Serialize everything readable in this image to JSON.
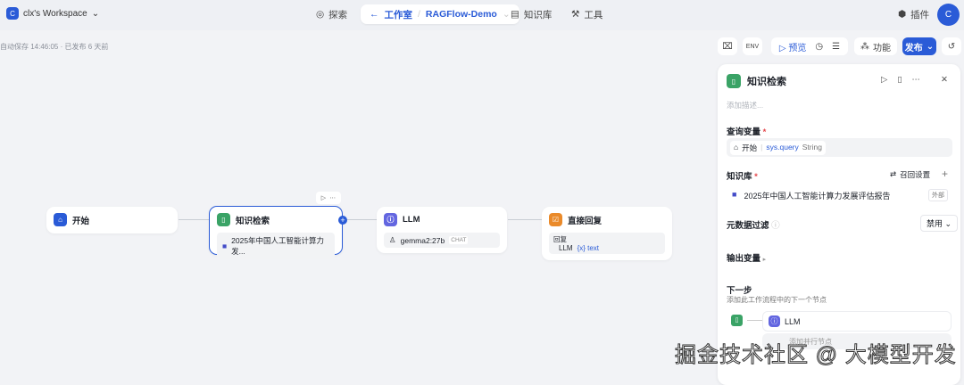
{
  "header": {
    "workspace_initial": "C",
    "workspace": "clx's Workspace",
    "explore": "探索",
    "studio": "工作室",
    "app": "RAGFlow-Demo",
    "knowledge": "知识库",
    "tools": "工具",
    "plugins": "插件",
    "user_initial": "C"
  },
  "status": "自动保存 14:46:05 · 已发布 6 天前",
  "toolbar": {
    "preview": "预览",
    "features": "功能",
    "publish": "发布"
  },
  "nodes": {
    "start": {
      "title": "开始"
    },
    "kr": {
      "title": "知识检索",
      "dataset": "2025年中国人工智能计算力发..."
    },
    "llm": {
      "title": "LLM",
      "model": "gemma2:27b",
      "badge": "CHAT"
    },
    "answer": {
      "title": "直接回复",
      "label": "回复",
      "src": "LLM",
      "var": "{x} text"
    }
  },
  "panel": {
    "title": "知识检索",
    "desc_placeholder": "添加描述...",
    "query_label": "查询变量",
    "query_node": "开始",
    "query_var": "sys.query",
    "query_type": "String",
    "kb_label": "知识库",
    "recall": "召回设置",
    "dataset": "2025年中国人工智能计算力发展评估报告",
    "dataset_tag": "外部",
    "metadata_label": "元数据过滤",
    "metadata_value": "禁用",
    "output_label": "输出变量",
    "next_label": "下一步",
    "next_desc": "添加此工作流程中的下一个节点",
    "next_node": "LLM",
    "parallel": "添加并行节点"
  },
  "watermark": "掘金技术社区 @ 大模型开发"
}
